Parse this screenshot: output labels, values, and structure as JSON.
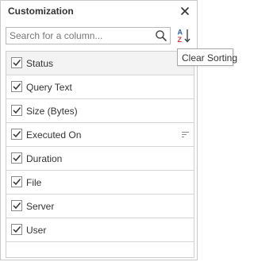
{
  "panel": {
    "title": "Customization",
    "close_icon": "close-icon"
  },
  "search": {
    "placeholder": "Search for a column...",
    "value": "",
    "icon": "search-icon"
  },
  "sort_button": {
    "icon": "sort-az-icon",
    "glyph_top": "A",
    "glyph_bottom": "Z",
    "tooltip": "Clear Sorting"
  },
  "columns": [
    {
      "label": "Status",
      "checked": true
    },
    {
      "label": "Query Text",
      "checked": true
    },
    {
      "label": "Size (Bytes)",
      "checked": true
    },
    {
      "label": "Executed On",
      "checked": true,
      "sorted": true
    },
    {
      "label": "Duration",
      "checked": true
    },
    {
      "label": "File",
      "checked": true
    },
    {
      "label": "Server",
      "checked": true
    },
    {
      "label": "User",
      "checked": true
    }
  ],
  "colors": {
    "accent_blue": "#2b5fb8",
    "accent_red": "#d23a3a",
    "text": "#333333"
  }
}
